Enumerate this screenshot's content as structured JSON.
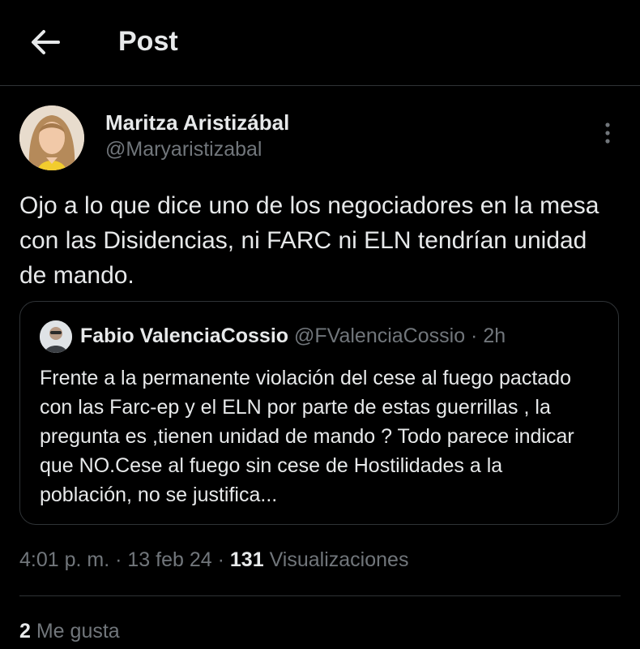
{
  "header": {
    "title": "Post",
    "back_icon": "arrow-left-icon"
  },
  "tweet": {
    "author_name": "Maritza Aristizábal",
    "author_handle": "@Maryaristizabal",
    "more_icon": "more-vertical-icon",
    "text": "Ojo a lo que dice uno de los negociadores en la mesa con las Disidencias, ni FARC ni ELN tendrían unidad de mando.",
    "time": "4:01 p. m.",
    "sep1": "·",
    "date": "13 feb 24",
    "sep2": "·",
    "views_count": "131",
    "views_label": "Visualizaciones",
    "likes_count": "2",
    "likes_label": "Me gusta"
  },
  "quote": {
    "author_name": "Fabio ValenciaCossio",
    "author_handle": "@FValenciaCossio",
    "sep": "·",
    "time": "2h",
    "text": "Frente a la permanente violación del cese al fuego pactado con las Farc-ep y el ELN por parte de estas guerrillas , la pregunta es ,tienen unidad de mando ? Todo parece indicar que NO.Cese al fuego sin cese de Hostilidades a la población, no se justifica..."
  },
  "colors": {
    "background": "#000000",
    "text": "#e7e9ea",
    "secondary": "#71767b",
    "border": "#2f3336"
  }
}
